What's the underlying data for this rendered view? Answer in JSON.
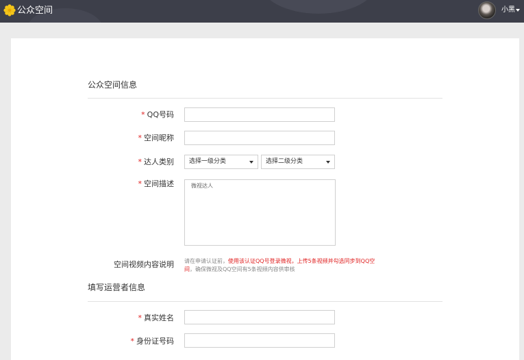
{
  "header": {
    "app_title": "公众空间",
    "username": "小黑",
    "icons": {
      "logo": "sunflower-logo-icon",
      "avatar": "user-avatar",
      "dropdown": "caret-down-icon"
    },
    "colors": {
      "bar": "#3d3f4a",
      "logo": "#f5c518"
    }
  },
  "form": {
    "required_mark": "*",
    "section1_title": "公众空间信息",
    "qq_label": "QQ号码",
    "qq_value": "",
    "nickname_label": "空间昵称",
    "nickname_value": "",
    "category_label": "达人类别",
    "category1_value": "选择一级分类",
    "category2_value": "选择二级分类",
    "description_label": "空间描述",
    "description_placeholder": "微视达人",
    "video_note_label": "空间视频内容说明",
    "video_note_prefix": "请在申请认证前，",
    "video_note_highlight": "使用该认证QQ号登录微视，上传5条视频并勾选同步到QQ空间",
    "video_note_suffix": "，确保微视及QQ空间有5条视频内容供审核",
    "section2_title": "填写运营者信息",
    "realname_label": "真实姓名",
    "realname_value": "",
    "idcard_label": "身份证号码",
    "idcard_value": "",
    "colors": {
      "required": "#e02020",
      "highlight": "#e02020"
    }
  }
}
